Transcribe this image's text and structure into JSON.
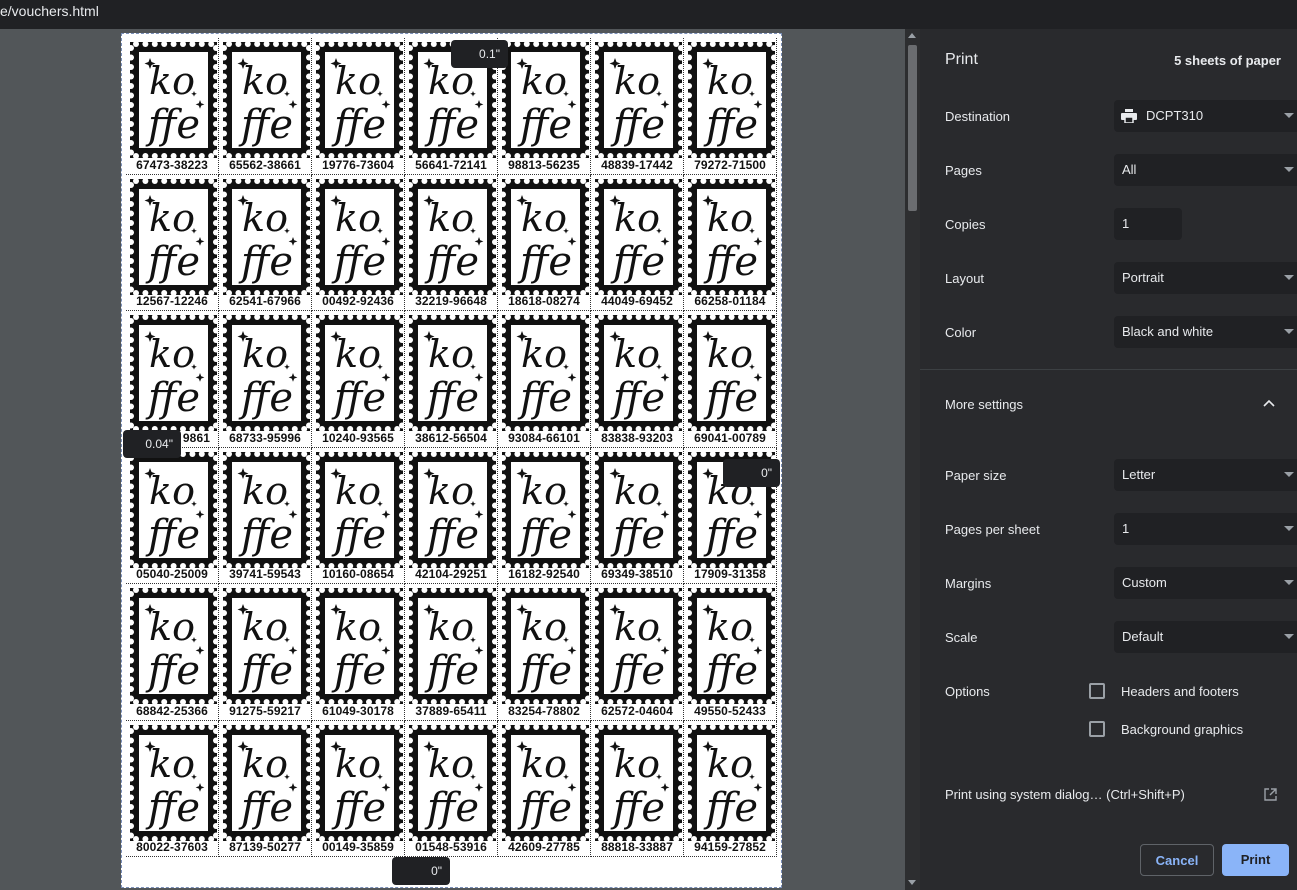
{
  "tab": {
    "url_fragment": "e/vouchers.html"
  },
  "preview": {
    "margin_tips": {
      "top": "0.1\"",
      "left": "0.04\"",
      "right": "0\"",
      "bottom": "0\""
    },
    "logo_text": {
      "top": "ko",
      "bottom": "ffe"
    },
    "codes": [
      "67473-38223",
      "65562-38661",
      "19776-73604",
      "56641-72141",
      "98813-56235",
      "48839-17442",
      "79272-71500",
      "12567-12246",
      "62541-67966",
      "00492-92436",
      "32219-96648",
      "18618-08274",
      "44049-69452",
      "66258-01184",
      "",
      "68733-95996",
      "10240-93565",
      "38612-56504",
      "93084-66101",
      "83838-93203",
      "69041-00789",
      "05040-25009",
      "39741-59543",
      "10160-08654",
      "42104-29251",
      "16182-92540",
      "69349-38510",
      "17909-31358",
      "68842-25366",
      "91275-59217",
      "61049-30178",
      "37889-65411",
      "83254-78802",
      "62572-04604",
      "49550-52433",
      "80022-37603",
      "87139-50277",
      "00149-35859",
      "01548-53916",
      "42609-27785",
      "88818-33887",
      "94159-27852"
    ],
    "partial_code_visible": "9861"
  },
  "print_panel": {
    "title": "Print",
    "sheets": "5 sheets of paper",
    "destination": {
      "label": "Destination",
      "value": "DCPT310"
    },
    "pages": {
      "label": "Pages",
      "value": "All"
    },
    "copies": {
      "label": "Copies",
      "value": "1"
    },
    "layout": {
      "label": "Layout",
      "value": "Portrait"
    },
    "color": {
      "label": "Color",
      "value": "Black and white"
    },
    "more_settings": "More settings",
    "paper_size": {
      "label": "Paper size",
      "value": "Letter"
    },
    "pages_per_sheet": {
      "label": "Pages per sheet",
      "value": "1"
    },
    "margins": {
      "label": "Margins",
      "value": "Custom"
    },
    "scale": {
      "label": "Scale",
      "value": "Default"
    },
    "options": {
      "label": "Options",
      "headers_footers": "Headers and footers",
      "background_graphics": "Background graphics"
    },
    "system_dialog": "Print using system dialog… (Ctrl+Shift+P)",
    "cancel": "Cancel",
    "print": "Print"
  },
  "colors": {
    "panel_bg": "#292a2d",
    "field_bg": "#202124",
    "accent": "#8ab4f8",
    "accent_text": "#202124"
  }
}
